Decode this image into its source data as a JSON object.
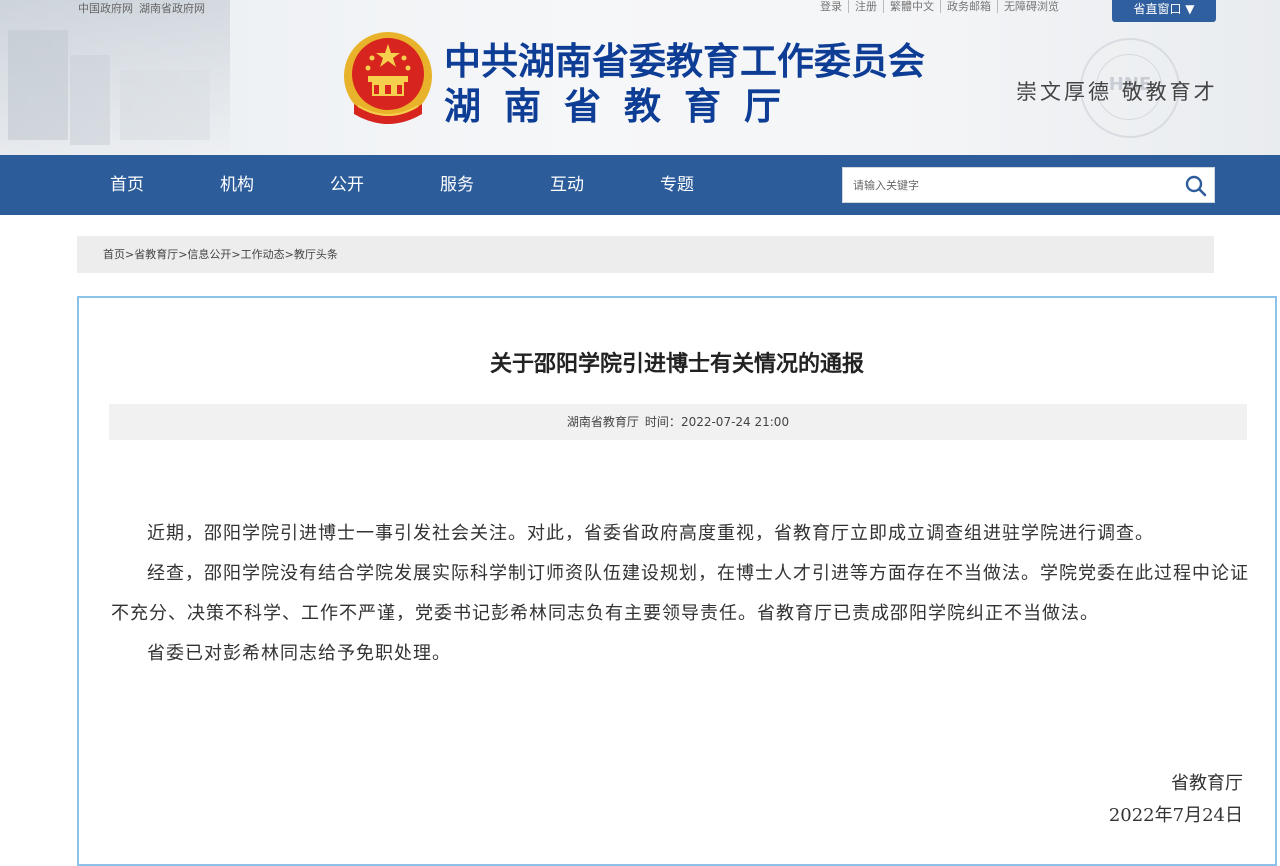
{
  "header": {
    "top_links": [
      "中国政府网",
      "湖南省政府网"
    ],
    "util_links": [
      "登录",
      "注册",
      "繁體中文",
      "政务邮箱",
      "无障碍浏览"
    ],
    "gov_button": "省直窗口 ▼",
    "title_line1": "中共湖南省委教育工作委员会",
    "title_line2": "湖南省教育厅",
    "motto": "崇文厚德  敬教育才",
    "seal_text": "HNE"
  },
  "nav": {
    "items": [
      "首页",
      "机构",
      "公开",
      "服务",
      "互动",
      "专题"
    ]
  },
  "search": {
    "placeholder": "请输入关键字"
  },
  "breadcrumb": "首页>省教育厅>信息公开>工作动态>教厅头条",
  "article": {
    "title": "关于邵阳学院引进博士有关情况的通报",
    "source": "湖南省教育厅",
    "time_label": "时间：",
    "time": "2022-07-24 21:00",
    "paragraphs": [
      "近期，邵阳学院引进博士一事引发社会关注。对此，省委省政府高度重视，省教育厅立即成立调查组进驻学院进行调查。",
      "经查，邵阳学院没有结合学院发展实际科学制订师资队伍建设规划，在博士人才引进等方面存在不当做法。学院党委在此过程中论证不充分、决策不科学、工作不严谨，党委书记彭希林同志负有主要领导责任。省教育厅已责成邵阳学院纠正不当做法。",
      "省委已对彭希林同志给予免职处理。"
    ],
    "signature": "省教育厅",
    "date": "2022年7月24日"
  },
  "colors": {
    "nav_bg": "#2d5c9b",
    "title_blue": "#0e3d95",
    "article_border": "#8cc1ea"
  }
}
